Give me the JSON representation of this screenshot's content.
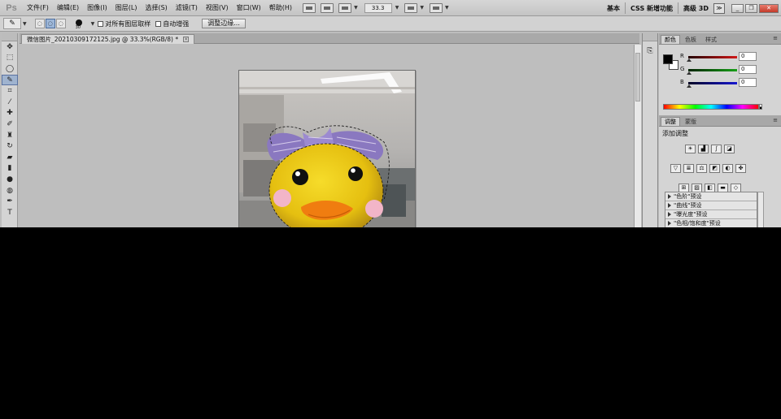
{
  "app": {
    "logo": "Ps"
  },
  "menu": [
    "文件(F)",
    "编辑(E)",
    "图像(I)",
    "图层(L)",
    "选择(S)",
    "滤镜(T)",
    "视图(V)",
    "窗口(W)",
    "帮助(H)"
  ],
  "menubar_right": {
    "zoom": "33.3",
    "workspaces": [
      "基本",
      "CSS 新增功能",
      "高级 3D"
    ]
  },
  "window_controls": {
    "minimize": "_",
    "restore": "❐",
    "close": "✕",
    "expand": "≫"
  },
  "options": {
    "tool_glyph": "✎",
    "brush_size": "30",
    "sample_all_layers": "对所有图层取样",
    "auto_enhance": "自动增强",
    "refine_edge": "调整边缘..."
  },
  "document": {
    "tab_title": "微信图片_20210309172125.jpg @ 33.3%(RGB/8) *"
  },
  "panels": {
    "color_tabs": [
      "颜色",
      "色板",
      "样式"
    ],
    "channels": [
      {
        "label": "R",
        "value": "0",
        "color": "#d01818"
      },
      {
        "label": "G",
        "value": "0",
        "color": "#18a018"
      },
      {
        "label": "B",
        "value": "0",
        "color": "#1818d0"
      }
    ],
    "adjust_tabs": [
      "调整",
      "蒙版"
    ],
    "adjust_title": "添加调整",
    "presets": [
      "\"色阶\"预设",
      "\"曲线\"预设",
      "\"曝光度\"预设",
      "\"色相/饱和度\"预设"
    ]
  },
  "tools": [
    "move-tool",
    "marquee-tool",
    "lasso-tool",
    "quick-selection-tool",
    "crop-tool",
    "eyedropper-tool",
    "healing-brush-tool",
    "brush-tool",
    "clone-stamp-tool",
    "history-brush-tool",
    "eraser-tool",
    "gradient-tool",
    "blur-tool",
    "dodge-tool",
    "pen-tool",
    "type-tool"
  ]
}
